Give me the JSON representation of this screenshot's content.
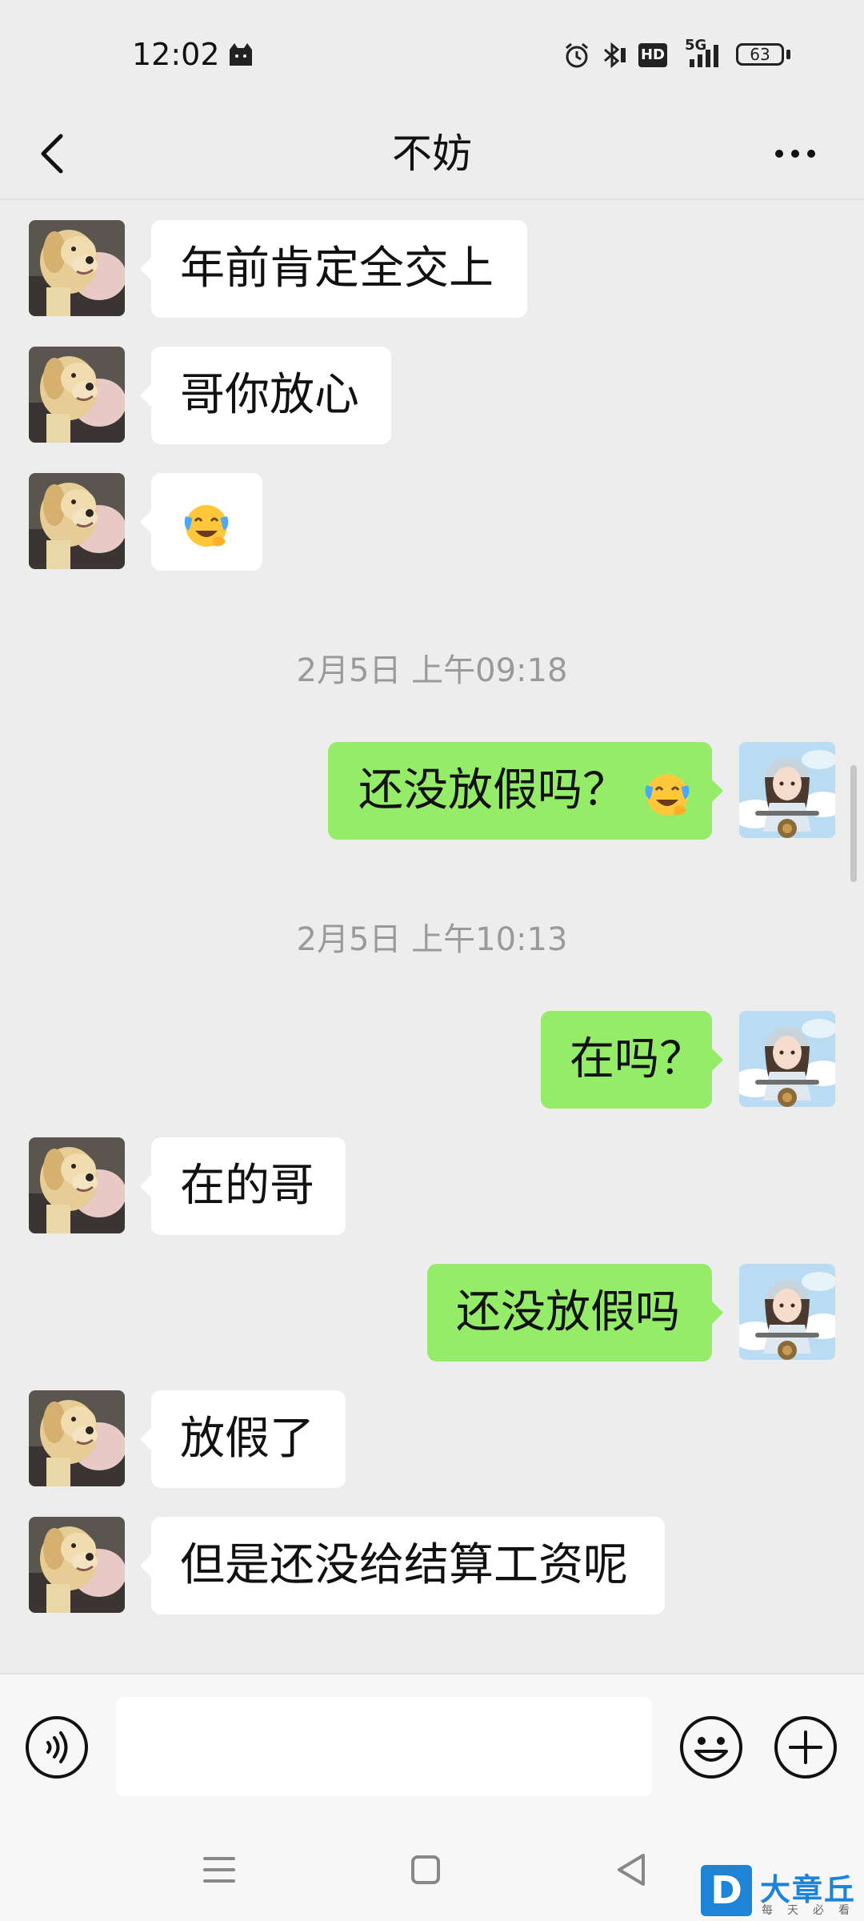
{
  "status_bar": {
    "time": "12:02",
    "network": "5G",
    "hd": "HD",
    "battery": "63"
  },
  "header": {
    "title": "不妨"
  },
  "messages": [
    {
      "from": "contact",
      "text": "年前肯定全交上"
    },
    {
      "from": "contact",
      "text": "哥你放心"
    },
    {
      "from": "contact",
      "emoji": "sad-laughing-emoji"
    },
    {
      "timestamp": "2月5日 上午09:18"
    },
    {
      "from": "me",
      "text": "还没放假吗？",
      "emoji": "sad-laughing-emoji"
    },
    {
      "timestamp": "2月5日 上午10:13"
    },
    {
      "from": "me",
      "text": "在吗？"
    },
    {
      "from": "contact",
      "text": "在的哥"
    },
    {
      "from": "me",
      "text": "还没放假吗"
    },
    {
      "from": "contact",
      "text": "放假了"
    },
    {
      "from": "contact",
      "text": "但是还没给结算工资呢"
    }
  ],
  "input": {
    "value": ""
  },
  "icons": {
    "back": "back-arrow-icon",
    "more": "more-options-icon",
    "voice": "voice-input-icon",
    "emoji": "emoji-icon",
    "plus": "add-icon"
  },
  "watermark": {
    "logo": "D",
    "name": "大章丘",
    "tagline": "每天必看"
  },
  "colors": {
    "background": "#ededed",
    "incoming_bubble": "#ffffff",
    "outgoing_bubble": "#95ec69",
    "timestamp": "#9a9a9a",
    "watermark": "#1e84d8"
  }
}
